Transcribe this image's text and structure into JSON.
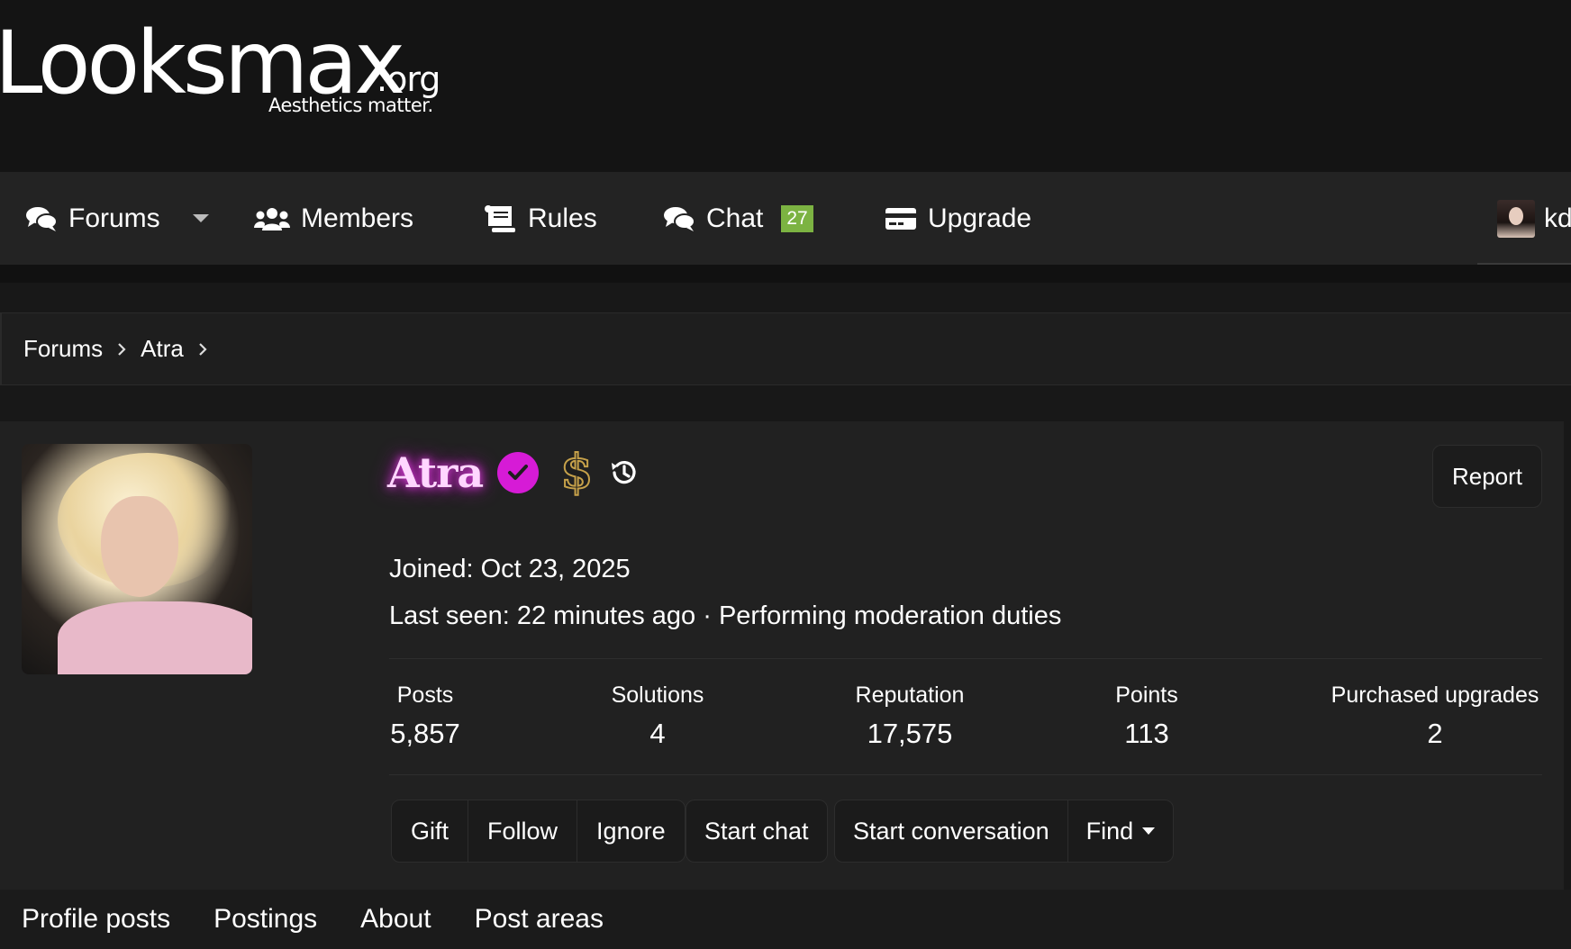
{
  "site": {
    "logo_main": "Looksmax",
    "logo_suffix": ".org",
    "tagline": "Aesthetics matter."
  },
  "nav": {
    "items": [
      {
        "label": "Forums",
        "icon": "comments-icon"
      },
      {
        "label": "Members",
        "icon": "users-icon"
      },
      {
        "label": "Rules",
        "icon": "scroll-icon"
      },
      {
        "label": "Chat",
        "icon": "chat-icon",
        "badge": "27"
      },
      {
        "label": "Upgrade",
        "icon": "credit-card-icon"
      }
    ],
    "user_label": "kd",
    "badge_color": "#7cb342"
  },
  "breadcrumb": [
    "Forums",
    "Atra"
  ],
  "profile": {
    "username": "Atra",
    "name_glow_color": "#d61bd6",
    "icons": [
      "verified-check-icon",
      "dollar-icon",
      "history-icon"
    ],
    "report_label": "Report",
    "joined": "Joined: Oct 23, 2025",
    "last_seen": "Last seen: 22 minutes ago · Performing moderation duties",
    "stats": [
      {
        "label": "Posts",
        "value": "5,857"
      },
      {
        "label": "Solutions",
        "value": "4"
      },
      {
        "label": "Reputation",
        "value": "17,575"
      },
      {
        "label": "Points",
        "value": "113"
      },
      {
        "label": "Purchased upgrades",
        "value": "2"
      }
    ],
    "actions_group1": [
      "Gift",
      "Follow",
      "Ignore"
    ],
    "actions_group2": [
      "Start chat"
    ],
    "actions_group3": [
      "Start conversation",
      "Find"
    ]
  },
  "tabs": [
    "Profile posts",
    "Postings",
    "About",
    "Post areas"
  ]
}
